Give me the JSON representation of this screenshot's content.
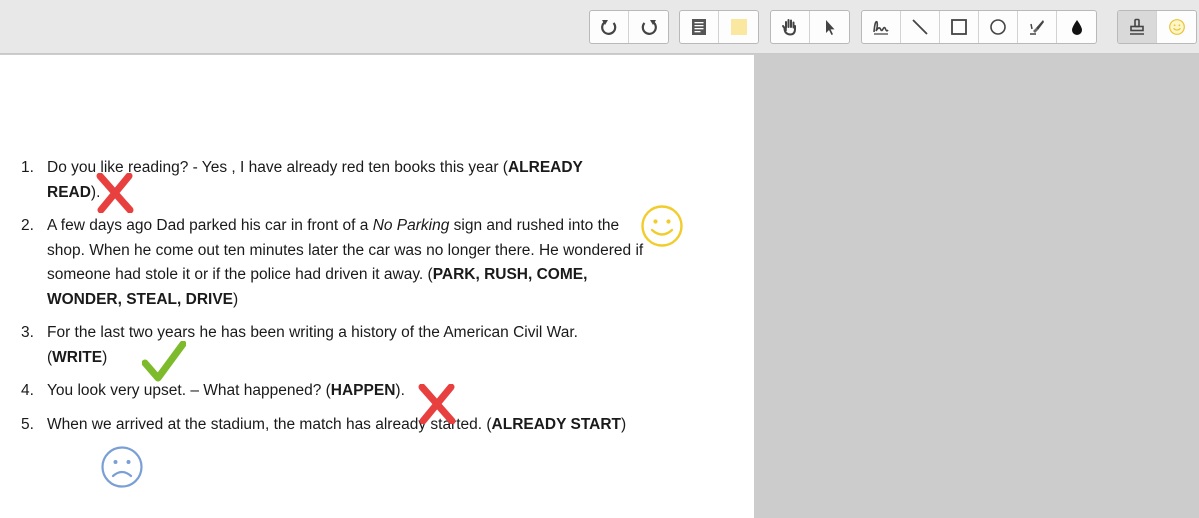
{
  "toolbar": {
    "groups": [
      {
        "name": "history",
        "buttons": [
          {
            "icon": "undo-icon"
          },
          {
            "icon": "redo-icon"
          }
        ]
      },
      {
        "name": "notes",
        "buttons": [
          {
            "icon": "text-note-icon"
          },
          {
            "icon": "sticky-note-icon"
          }
        ]
      },
      {
        "name": "navigation",
        "buttons": [
          {
            "icon": "hand-pan-icon"
          },
          {
            "icon": "pointer-icon"
          }
        ]
      },
      {
        "name": "drawing",
        "buttons": [
          {
            "icon": "freehand-pen-icon"
          },
          {
            "icon": "line-icon"
          },
          {
            "icon": "rectangle-icon"
          },
          {
            "icon": "ellipse-icon"
          },
          {
            "icon": "highlighter-icon"
          },
          {
            "icon": "ink-drop-icon"
          }
        ]
      },
      {
        "name": "stamps",
        "buttons": [
          {
            "icon": "stamp-icon"
          },
          {
            "icon": "smiley-stamp-icon"
          }
        ]
      }
    ]
  },
  "document": {
    "items": [
      {
        "number": "1.",
        "text_a": "Do you like reading? - Yes , I  have already red ten books this year (",
        "bold_a": "ALREADY READ",
        "text_b": ").",
        "annotation": "red-x-mark"
      },
      {
        "number": "2.",
        "text_a": "A few days ago Dad  parked his car in front of a ",
        "italic": "No Parking",
        "text_b": " sign and  rushed into the shop. When he come out ten minutes later the car was no longer there. He wondered  if someone had stole it or if the police had driven  it away. (",
        "bold_a": "PARK, RUSH, COME, WONDER, STEAL, DRIVE",
        "text_c": ")",
        "annotation": "smiley-face"
      },
      {
        "number": "3.",
        "text_a": "For the last two years he has been writing a history of the American Civil War.(",
        "bold_a": "WRITE",
        "text_b": ")",
        "annotation": "green-check-mark"
      },
      {
        "number": "4.",
        "text_a": "You look very upset. – What happened? (",
        "bold_a": "HAPPEN",
        "text_b": ").",
        "annotation": "red-x-mark"
      },
      {
        "number": "5.",
        "text_a": "When we arrived at the stadium, the match has already started.  (",
        "bold_a": "ALREADY START",
        "text_b": ")",
        "annotation": "sad-face"
      }
    ]
  },
  "colors": {
    "toolbar_bg": "#e8e8e8",
    "canvas_bg": "#cccccc",
    "x_mark": "#e8403f",
    "check_mark": "#7dbb2c",
    "smiley": "#f2cc2b",
    "sad_face": "#7a9fd6"
  }
}
